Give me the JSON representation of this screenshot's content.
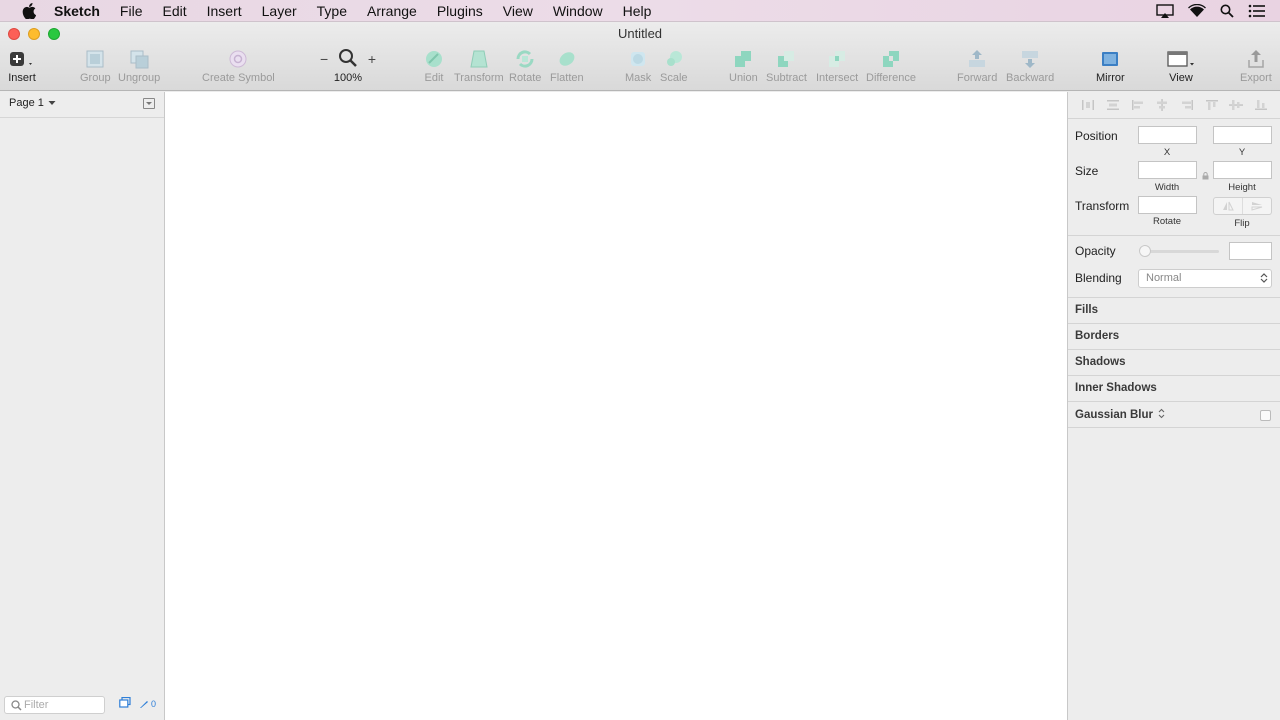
{
  "menubar": {
    "app": "Sketch",
    "items": [
      "File",
      "Edit",
      "Insert",
      "Layer",
      "Type",
      "Arrange",
      "Plugins",
      "View",
      "Window",
      "Help"
    ],
    "status_icons": [
      "airplay-icon",
      "wifi-icon",
      "search-icon",
      "notification-list-icon"
    ]
  },
  "window": {
    "title": "Untitled"
  },
  "toolbar": {
    "insert": "Insert",
    "group": "Group",
    "ungroup": "Ungroup",
    "create_symbol": "Create Symbol",
    "zoom_minus": "−",
    "zoom_plus": "+",
    "zoom_level": "100%",
    "edit": "Edit",
    "transform": "Transform",
    "rotate": "Rotate",
    "flatten": "Flatten",
    "mask": "Mask",
    "scale": "Scale",
    "union": "Union",
    "subtract": "Subtract",
    "intersect": "Intersect",
    "difference": "Difference",
    "forward": "Forward",
    "backward": "Backward",
    "mirror": "Mirror",
    "view": "View",
    "export": "Export"
  },
  "layers": {
    "page": "Page 1",
    "filter_placeholder": "Filter",
    "slice_count": "0"
  },
  "inspector": {
    "position_label": "Position",
    "x_label": "X",
    "y_label": "Y",
    "size_label": "Size",
    "width_label": "Width",
    "height_label": "Height",
    "transform_label": "Transform",
    "rotate_label": "Rotate",
    "flip_label": "Flip",
    "opacity_label": "Opacity",
    "blending_label": "Blending",
    "blending_value": "Normal",
    "sections": [
      "Fills",
      "Borders",
      "Shadows",
      "Inner Shadows",
      "Gaussian Blur"
    ]
  },
  "colors": {
    "close": "#fc5f57",
    "minimize": "#fdbc2e",
    "maximize": "#29c840",
    "disabled_icon": "#8ed6bf",
    "mirror_icon": "#3b7fc4"
  }
}
